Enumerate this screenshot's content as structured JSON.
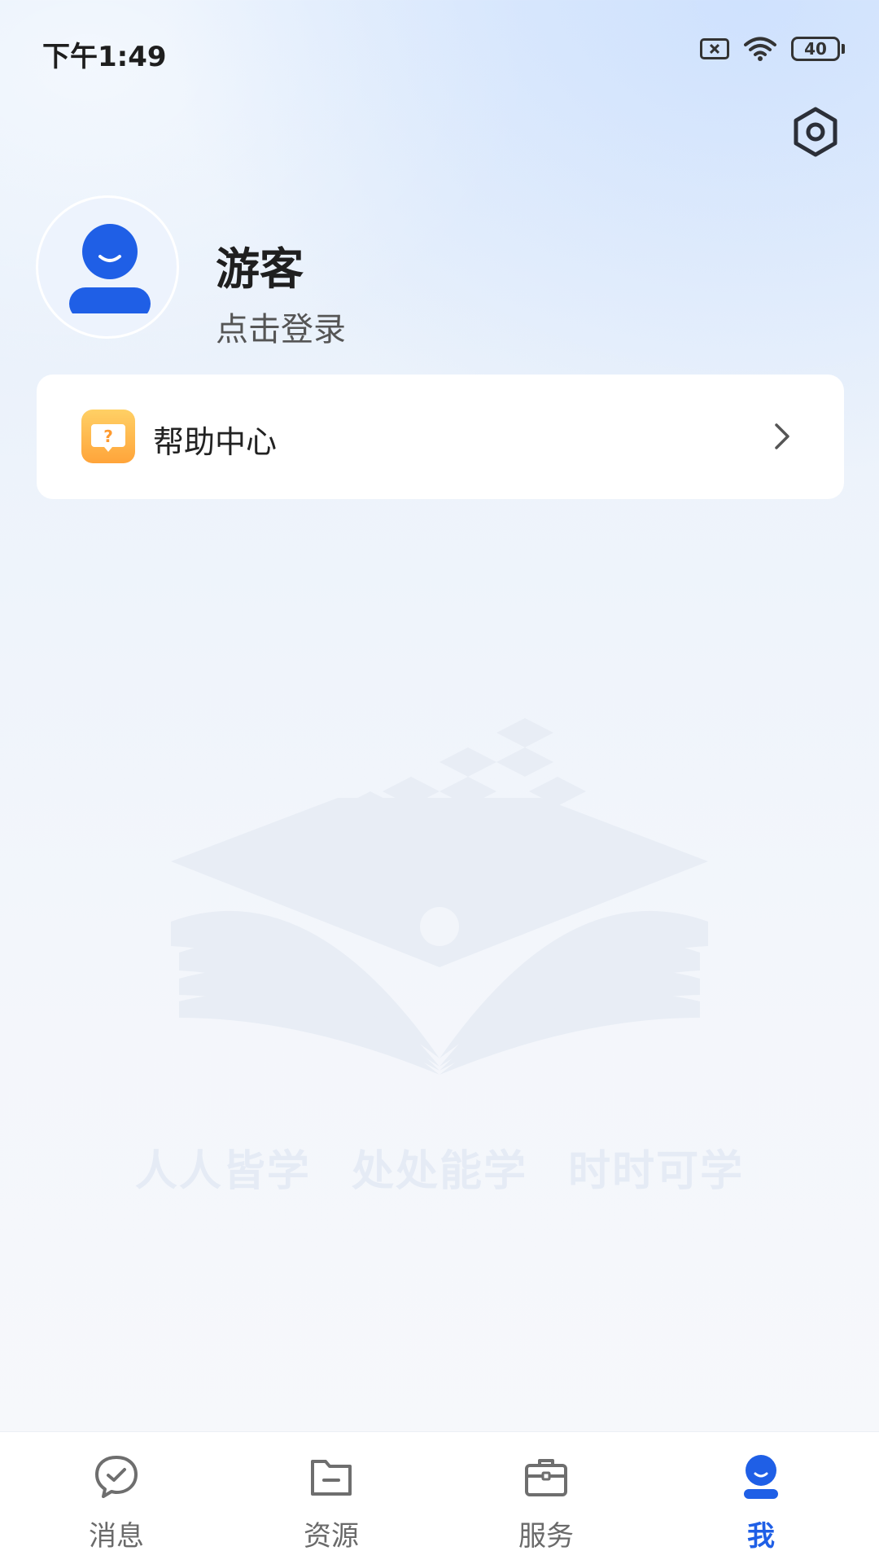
{
  "status_bar": {
    "time": "下午1:49",
    "battery": "40"
  },
  "profile": {
    "name": "游客",
    "login_prompt": "点击登录"
  },
  "menu": [
    {
      "label": "帮助中心",
      "icon": "question-bubble-icon"
    }
  ],
  "watermark": {
    "slogan": "人人皆学 处处能学  时时可学"
  },
  "tabs": [
    {
      "label": "消息",
      "icon": "chat-check-icon"
    },
    {
      "label": "资源",
      "icon": "folder-icon"
    },
    {
      "label": "服务",
      "icon": "briefcase-icon"
    },
    {
      "label": "我",
      "icon": "user-icon"
    }
  ],
  "active_tab": "我",
  "colors": {
    "accent": "#1f5fe6",
    "help_icon": "#ffb84a"
  }
}
